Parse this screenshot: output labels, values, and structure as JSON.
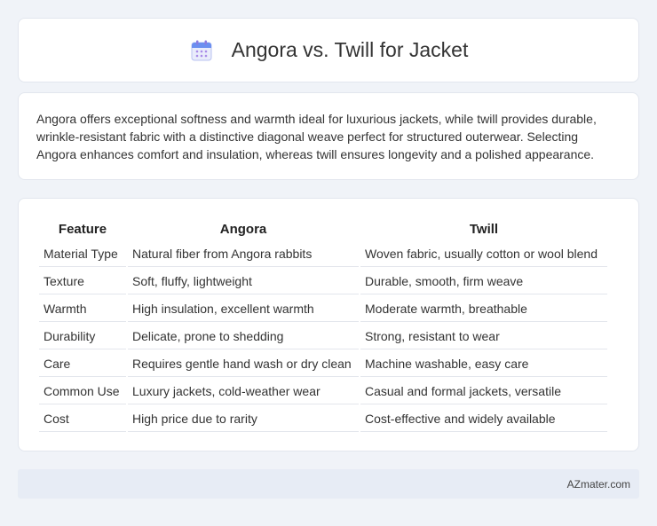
{
  "title": "Angora vs. Twill for Jacket",
  "summary": "Angora offers exceptional softness and warmth ideal for luxurious jackets, while twill provides durable, wrinkle-resistant fabric with a distinctive diagonal weave perfect for structured outerwear. Selecting Angora enhances comfort and insulation, whereas twill ensures longevity and a polished appearance.",
  "table": {
    "headers": [
      "Feature",
      "Angora",
      "Twill"
    ],
    "rows": [
      [
        "Material Type",
        "Natural fiber from Angora rabbits",
        "Woven fabric, usually cotton or wool blend"
      ],
      [
        "Texture",
        "Soft, fluffy, lightweight",
        "Durable, smooth, firm weave"
      ],
      [
        "Warmth",
        "High insulation, excellent warmth",
        "Moderate warmth, breathable"
      ],
      [
        "Durability",
        "Delicate, prone to shedding",
        "Strong, resistant to wear"
      ],
      [
        "Care",
        "Requires gentle hand wash or dry clean",
        "Machine washable, easy care"
      ],
      [
        "Common Use",
        "Luxury jackets, cold-weather wear",
        "Casual and formal jackets, versatile"
      ],
      [
        "Cost",
        "High price due to rarity",
        "Cost-effective and widely available"
      ]
    ]
  },
  "footer": {
    "site": "AZmater.com"
  },
  "icons": {
    "title_icon": "calendar-icon"
  },
  "colors": {
    "background": "#f0f3f8",
    "card": "#ffffff",
    "footer_bg": "#e7ecf5",
    "icon_accent": "#6b8ff0"
  }
}
